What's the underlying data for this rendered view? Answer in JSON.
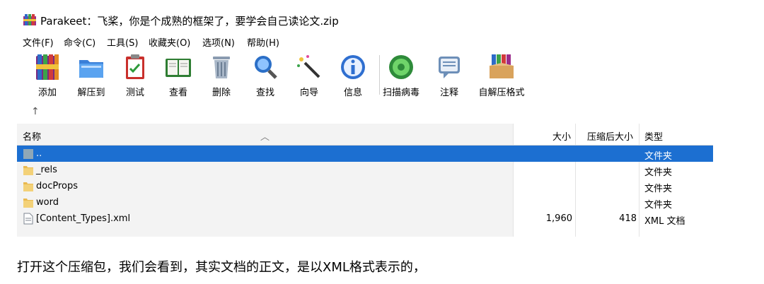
{
  "window": {
    "title": "Parakeet：飞桨，你是个成熟的框架了，要学会自己读论文.zip"
  },
  "menu": {
    "items": [
      {
        "label": "文件(F)"
      },
      {
        "label": "命令(C)"
      },
      {
        "label": "工具(S)"
      },
      {
        "label": "收藏夹(O)"
      },
      {
        "label": "选项(N)"
      },
      {
        "label": "帮助(H)"
      }
    ]
  },
  "toolbar": {
    "buttons": [
      {
        "label": "添加",
        "icon": "add-books-icon"
      },
      {
        "label": "解压到",
        "icon": "extract-folder-icon"
      },
      {
        "label": "测试",
        "icon": "test-clipboard-icon"
      },
      {
        "label": "查看",
        "icon": "view-book-icon"
      },
      {
        "label": "删除",
        "icon": "trash-icon"
      },
      {
        "label": "查找",
        "icon": "magnifier-icon"
      },
      {
        "label": "向导",
        "icon": "wizard-wand-icon"
      },
      {
        "label": "信息",
        "icon": "info-icon"
      },
      {
        "label": "扫描病毒",
        "icon": "virus-scan-icon"
      },
      {
        "label": "注释",
        "icon": "comment-icon"
      },
      {
        "label": "自解压格式",
        "icon": "sfx-box-icon"
      }
    ],
    "up_arrow": "↑"
  },
  "list": {
    "columns": {
      "name": "名称",
      "size": "大小",
      "packed": "压缩后大小",
      "type": "类型"
    },
    "rows": [
      {
        "name": "..",
        "size": "",
        "packed": "",
        "type": "文件夹",
        "icon": "parent-folder-icon",
        "selected": true
      },
      {
        "name": "_rels",
        "size": "",
        "packed": "",
        "type": "文件夹",
        "icon": "folder-icon",
        "selected": false
      },
      {
        "name": "docProps",
        "size": "",
        "packed": "",
        "type": "文件夹",
        "icon": "folder-icon",
        "selected": false
      },
      {
        "name": "word",
        "size": "",
        "packed": "",
        "type": "文件夹",
        "icon": "folder-icon",
        "selected": false
      },
      {
        "name": "[Content_Types].xml",
        "size": "1,960",
        "packed": "418",
        "type": "XML 文档",
        "icon": "xml-file-icon",
        "selected": false
      }
    ]
  },
  "caption": "打开这个压缩包，我们会看到，其实文档的正文，是以XML格式表示的，",
  "colors": {
    "selection": "#1c6fd1",
    "folder": "#f3d178",
    "list_bg": "#f3f3f3"
  }
}
